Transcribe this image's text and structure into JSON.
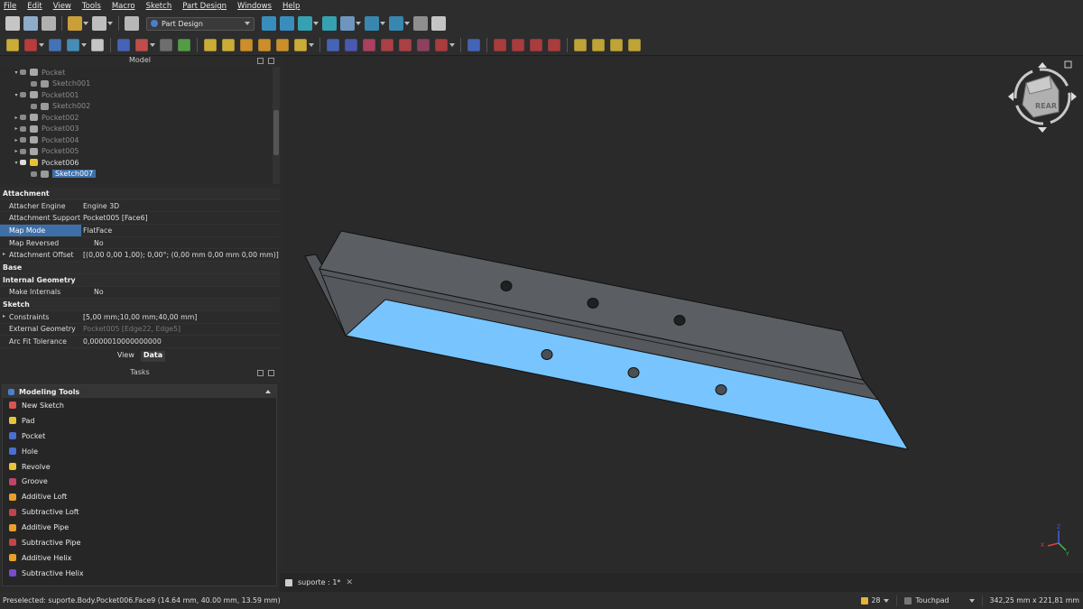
{
  "menu": [
    "File",
    "Edit",
    "View",
    "Tools",
    "Macro",
    "Sketch",
    "Part Design",
    "Windows",
    "Help"
  ],
  "workbench": {
    "selected": "Part Design"
  },
  "toolbar1_icons": [
    "new-file-icon",
    "open-file-icon",
    "save-icon",
    "undo-icon",
    "redo-icon",
    "refresh-icon",
    "fit-all-icon",
    "fit-selection-icon",
    "view-cube-icon",
    "measure-icon",
    "std-views-icon",
    "box-select-icon",
    "zoom-icon",
    "measure-tool-icon",
    "what-is-this-icon"
  ],
  "toolbar2_icons": [
    "body-icon",
    "lcs-icon",
    "part-icon",
    "link-icon",
    "expression-icon",
    "shape-binder-icon",
    "sketch-icon",
    "validate-sketch-icon",
    "clone-icon",
    "pad-icon",
    "revolve-icon",
    "loft-icon",
    "pipe-icon",
    "helix-icon",
    "primitive-icon",
    "pocket-icon",
    "hole-icon",
    "groove-icon",
    "sub-loft-icon",
    "sub-pipe-icon",
    "sub-helix-icon",
    "sub-primitive-icon",
    "mirror-icon",
    "fillet-icon",
    "chamfer-icon",
    "draft-icon",
    "thickness-icon",
    "linear-pattern-icon",
    "polar-pattern-icon",
    "scaled-icon",
    "multi-transform-icon"
  ],
  "model_panel": {
    "title": "Model",
    "tree": [
      {
        "label": "Pocket",
        "indent": 1,
        "expanded": true,
        "grey": true,
        "icon": "pocket"
      },
      {
        "label": "Sketch001",
        "indent": 2,
        "grey": true,
        "icon": "sketch"
      },
      {
        "label": "Pocket001",
        "indent": 1,
        "expanded": true,
        "grey": true,
        "icon": "pocket"
      },
      {
        "label": "Sketch002",
        "indent": 2,
        "grey": true,
        "icon": "sketch"
      },
      {
        "label": "Pocket002",
        "indent": 1,
        "grey": true,
        "icon": "pocket"
      },
      {
        "label": "Pocket003",
        "indent": 1,
        "grey": true,
        "icon": "pocket"
      },
      {
        "label": "Pocket004",
        "indent": 1,
        "grey": true,
        "icon": "pocket"
      },
      {
        "label": "Pocket005",
        "indent": 1,
        "grey": true,
        "icon": "pocket"
      },
      {
        "label": "Pocket006",
        "indent": 1,
        "expanded": true,
        "grey": false,
        "icon": "pocket-visible"
      },
      {
        "label": "Sketch007",
        "indent": 2,
        "selected": true,
        "icon": "sketch"
      }
    ]
  },
  "properties": [
    {
      "group": "Attachment"
    },
    {
      "key": "Attacher Engine",
      "value": "Engine 3D"
    },
    {
      "key": "Attachment Support",
      "value": "Pocket005 [Face6]"
    },
    {
      "key": "Map Mode",
      "value": "FlatFace",
      "highlight": true
    },
    {
      "key": "Map Reversed",
      "value": "No",
      "checkbox": true
    },
    {
      "key": "Attachment Offset",
      "value": "[(0,00 0,00 1,00); 0,00°; (0,00 mm  0,00 mm  0,00 mm)]",
      "expandable": true
    },
    {
      "group": "Base"
    },
    {
      "group": "Internal Geometry"
    },
    {
      "key": "Make Internals",
      "value": "No",
      "checkbox": true
    },
    {
      "group": "Sketch"
    },
    {
      "key": "Constraints",
      "value": "[5,00 mm;10,00 mm;40,00 mm]",
      "expandable": true
    },
    {
      "key": "External Geometry",
      "value": "Pocket005 [Edge22, Edge5]",
      "dim": true
    },
    {
      "key": "Arc Fit Tolerance",
      "value": "0,0000010000000000"
    }
  ],
  "view_tabs": {
    "view": "View",
    "data": "Data"
  },
  "tasks_panel": {
    "title": "Tasks",
    "section": "Modeling Tools",
    "items": [
      {
        "label": "New Sketch",
        "color": "#d9534f"
      },
      {
        "label": "Pad",
        "color": "#e8c33a"
      },
      {
        "label": "Pocket",
        "color": "#4a6fcf"
      },
      {
        "label": "Hole",
        "color": "#4a6fcf"
      },
      {
        "label": "Revolve",
        "color": "#e8c33a"
      },
      {
        "label": "Groove",
        "color": "#c0446a"
      },
      {
        "label": "Additive Loft",
        "color": "#e8a02a"
      },
      {
        "label": "Subtractive Loft",
        "color": "#c0444a"
      },
      {
        "label": "Additive Pipe",
        "color": "#e8a02a"
      },
      {
        "label": "Subtractive Pipe",
        "color": "#c0444a"
      },
      {
        "label": "Additive Helix",
        "color": "#e8a02a"
      },
      {
        "label": "Subtractive Helix",
        "color": "#7a4acf"
      }
    ]
  },
  "navcube": {
    "face": "REAR"
  },
  "document_tab": {
    "label": "suporte : 1*",
    "close": "✕"
  },
  "status": {
    "preselected": "Preselected: suporte.Body.Pocket006.Face9 (14.64 mm, 40.00 mm, 13.59 mm)",
    "cache": "28",
    "navigation": "Touchpad",
    "dimensions": "342,25 mm x 221,81 mm"
  },
  "colors": {
    "selected_face": "#77c4ff",
    "body": "#5a5d61",
    "accent": "#3f6fa8"
  }
}
